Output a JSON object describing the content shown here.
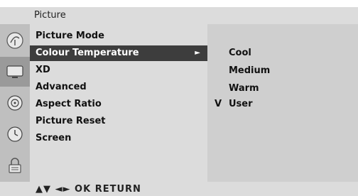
{
  "header": {
    "title": "Picture"
  },
  "menu": {
    "items": [
      {
        "label": "Picture Mode"
      },
      {
        "label": "Colour Temperature",
        "arrow": "►"
      },
      {
        "label": "XD"
      },
      {
        "label": "Advanced"
      },
      {
        "label": "Aspect Ratio"
      },
      {
        "label": "Picture Reset"
      },
      {
        "label": "Screen"
      }
    ]
  },
  "submenu": {
    "items": [
      {
        "label": "Cool"
      },
      {
        "label": "Medium"
      },
      {
        "label": "Warm"
      },
      {
        "label": "User",
        "mark": "V"
      }
    ]
  },
  "footer": {
    "hint": "▲▼ ◄► OK RETURN"
  },
  "sidebar_icons": [
    "satellite-dish-icon",
    "tv-screen-icon",
    "audio-disc-icon",
    "clock-icon",
    "lock-icon"
  ],
  "colors": {
    "selected_bg": "#3d3d3d",
    "panel_bg": "#dcdcdc",
    "icon_bar": "#bfbfbf"
  }
}
